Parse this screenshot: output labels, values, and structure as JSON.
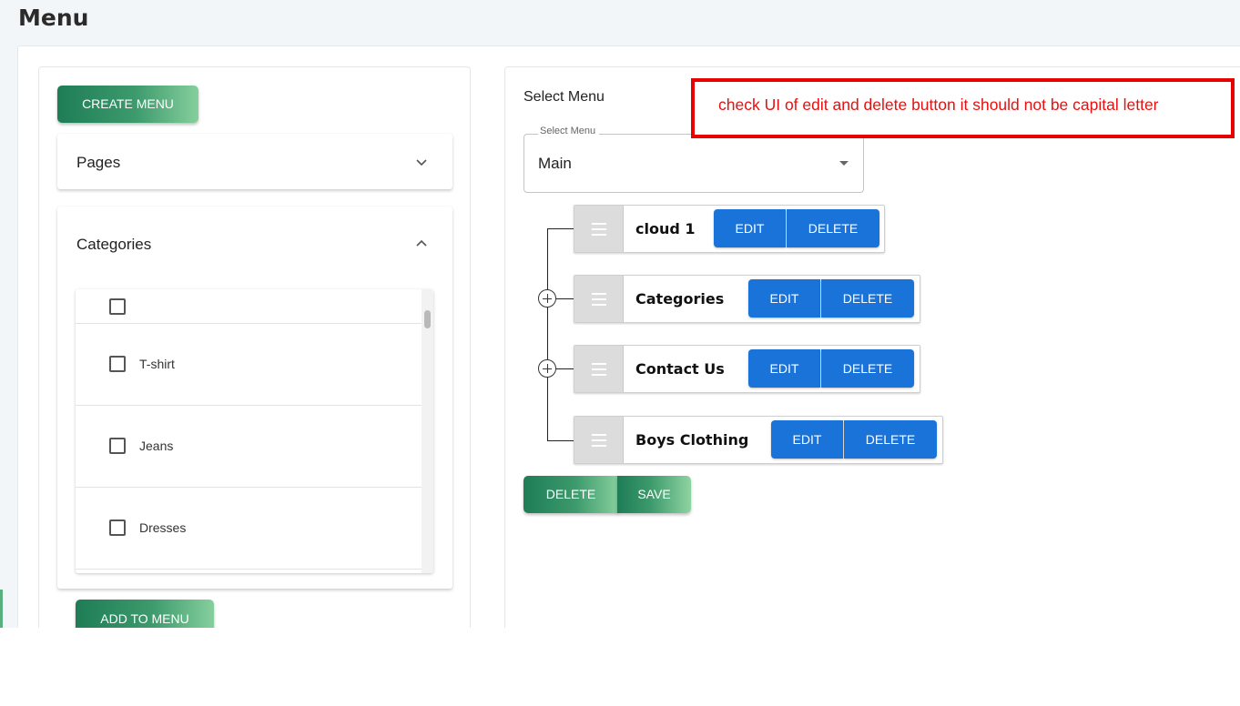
{
  "page": {
    "title": "Menu"
  },
  "left": {
    "create_button": "CREATE MENU",
    "pages_label": "Pages",
    "categories_label": "Categories",
    "categories": [
      "T-shirt",
      "Jeans",
      "Dresses"
    ],
    "add_button": "ADD TO MENU"
  },
  "right": {
    "select_title": "Select Menu",
    "select_legend": "Select Menu",
    "select_value": "Main",
    "items": [
      {
        "label": "cloud 1",
        "edit": "EDIT",
        "delete": "DELETE"
      },
      {
        "label": "Categories",
        "edit": "EDIT",
        "delete": "DELETE"
      },
      {
        "label": "Contact Us",
        "edit": "EDIT",
        "delete": "DELETE"
      },
      {
        "label": "Boys Clothing",
        "edit": "EDIT",
        "delete": "DELETE"
      }
    ],
    "delete_button": "DELETE",
    "save_button": "SAVE"
  },
  "annotation": {
    "text": "check UI of edit and delete button it should not be capital letter"
  },
  "colors": {
    "accent_green": "#3c9a6c",
    "button_blue": "#1a73d9",
    "annotation_red": "#e60000"
  },
  "icons": {
    "pages_toggle": "chevron-down-icon",
    "categories_toggle": "chevron-up-icon",
    "drag": "drag-handle-icon",
    "expand": "plus-circle-icon"
  }
}
